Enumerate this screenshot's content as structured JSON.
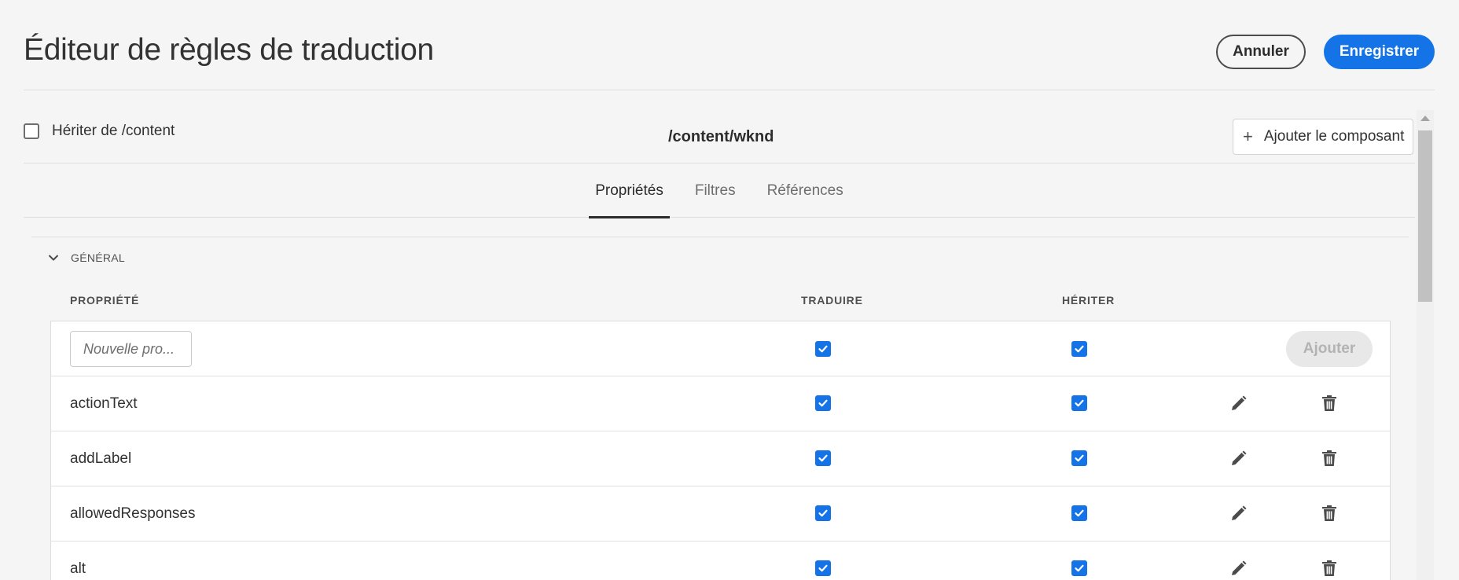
{
  "header": {
    "title": "Éditeur de règles de traduction",
    "cancel_label": "Annuler",
    "save_label": "Enregistrer"
  },
  "pathbar": {
    "inherit_label": "Hériter de /content",
    "inherit_checked": false,
    "path": "/content/wknd",
    "add_component_label": "Ajouter le composant"
  },
  "tabs": [
    {
      "label": "Propriétés",
      "active": true
    },
    {
      "label": "Filtres",
      "active": false
    },
    {
      "label": "Références",
      "active": false
    }
  ],
  "section": {
    "label": "GÉNÉRAL",
    "expanded": true
  },
  "columns": {
    "property": "PROPRIÉTÉ",
    "translate": "TRADUIRE",
    "inherit": "HÉRITER"
  },
  "new_row": {
    "placeholder": "Nouvelle pro...",
    "translate": true,
    "inherit": true,
    "add_label": "Ajouter"
  },
  "rows": [
    {
      "name": "actionText",
      "translate": true,
      "inherit": true
    },
    {
      "name": "addLabel",
      "translate": true,
      "inherit": true
    },
    {
      "name": "allowedResponses",
      "translate": true,
      "inherit": true
    },
    {
      "name": "alt",
      "translate": true,
      "inherit": true
    }
  ],
  "colors": {
    "accent": "#1473e6",
    "background": "#f5f5f5"
  },
  "icons": {
    "edit": "pencil-icon",
    "delete": "trash-icon",
    "collapse": "chevron-down-icon",
    "add": "plus-icon"
  }
}
